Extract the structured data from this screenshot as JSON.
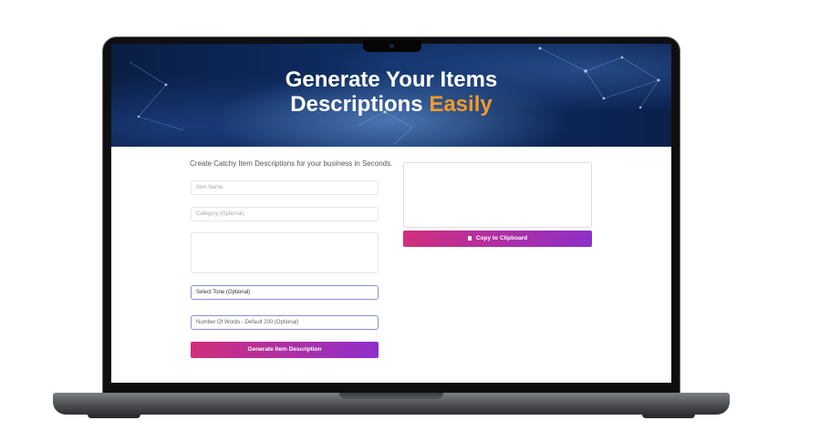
{
  "hero": {
    "title_line1": "Generate Your Items",
    "title_line2": "Descriptions",
    "title_accent": "Easily",
    "accent_color": "#f39a2b"
  },
  "form": {
    "intro": "Create Catchy Item Descriptions for your business in Seconds.",
    "item_name_placeholder": "Item Name",
    "category_placeholder": "Category (Optional)",
    "details_placeholder": "",
    "tone_selected": "Select Tone (Optional)",
    "words_placeholder": "Number Of Words - Default 200 (Optional)",
    "generate_label": "Generate Item Description"
  },
  "output": {
    "copy_label": "Copy to Clipboard",
    "copy_icon": "clipboard-icon"
  },
  "colors": {
    "button_gradient_start": "#d02f7d",
    "button_gradient_end": "#8f2fc9"
  }
}
